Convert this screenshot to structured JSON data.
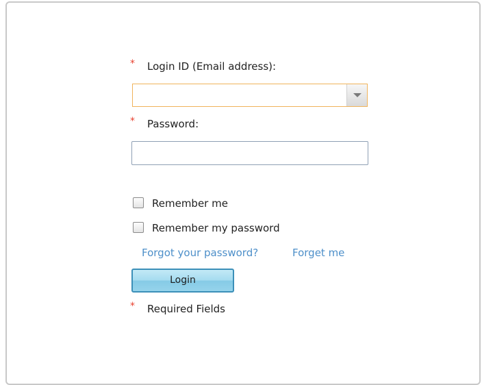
{
  "form": {
    "login_label": "Login ID (Email address):",
    "login_value": "",
    "password_label": "Password:",
    "password_value": "",
    "required_marker": "*",
    "remember_me_label": "Remember me",
    "remember_me_checked": false,
    "remember_password_label": "Remember my password",
    "remember_password_checked": false,
    "forgot_password_link": "Forgot your password?",
    "forget_me_link": "Forget me",
    "login_button": "Login",
    "required_fields_note": "Required Fields"
  },
  "colors": {
    "required_star": "#e8412f",
    "link": "#4d8fc9",
    "combo_focus_border": "#f0b35a",
    "button_border": "#3b8fb8",
    "button_fill": "#a6dcf0"
  },
  "icons": {
    "combo_dropdown": "chevron-down-icon"
  }
}
